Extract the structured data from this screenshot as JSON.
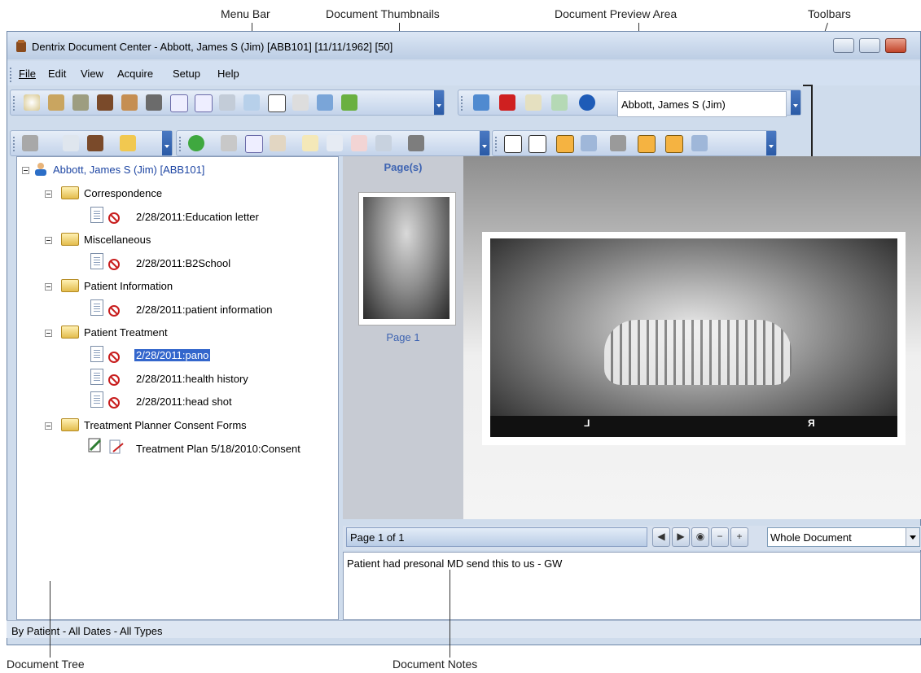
{
  "callouts": {
    "menu_bar": "Menu Bar",
    "document_thumbnails": "Document Thumbnails",
    "document_preview_area": "Document Preview Area",
    "toolbars": "Toolbars",
    "document_tree": "Document Tree",
    "document_notes": "Document Notes"
  },
  "window": {
    "title": "Dentrix Document Center - Abbott, James S (Jim) [ABB101] [11/11/1962] [50]"
  },
  "menubar": {
    "items": [
      "File",
      "Edit",
      "View",
      "Acquire",
      "Setup",
      "Help"
    ]
  },
  "toolbar": {
    "patient_name": "Abbott, James S (Jim)"
  },
  "tree": {
    "root": "Abbott, James S (Jim) [ABB101]",
    "folders": [
      {
        "name": "Correspondence",
        "docs": [
          "2/28/2011:Education letter"
        ]
      },
      {
        "name": "Miscellaneous",
        "docs": [
          "2/28/2011:B2School"
        ]
      },
      {
        "name": "Patient Information",
        "docs": [
          "2/28/2011:patient information"
        ]
      },
      {
        "name": "Patient Treatment",
        "docs": [
          "2/28/2011:pano",
          "2/28/2011:health history",
          "2/28/2011:head shot"
        ]
      },
      {
        "name": "Treatment Planner Consent Forms",
        "docs": [
          "Treatment Plan 5/18/2010:Consent"
        ]
      }
    ],
    "selected": "2/28/2011:pano"
  },
  "status_bar": {
    "filter": "By Patient - All Dates - All Types"
  },
  "thumbnails": {
    "header": "Page(s)",
    "pages": [
      "Page 1"
    ]
  },
  "preview": {
    "left_marker": "L",
    "right_marker": "R"
  },
  "page_nav": {
    "page_text": "Page 1 of 1",
    "zoom_value": "Whole Document"
  },
  "notes": {
    "text": "Patient had presonal MD send this to us - GW"
  },
  "colors": {
    "accent": "#3366cc",
    "error_icon": "#c81e1e"
  }
}
